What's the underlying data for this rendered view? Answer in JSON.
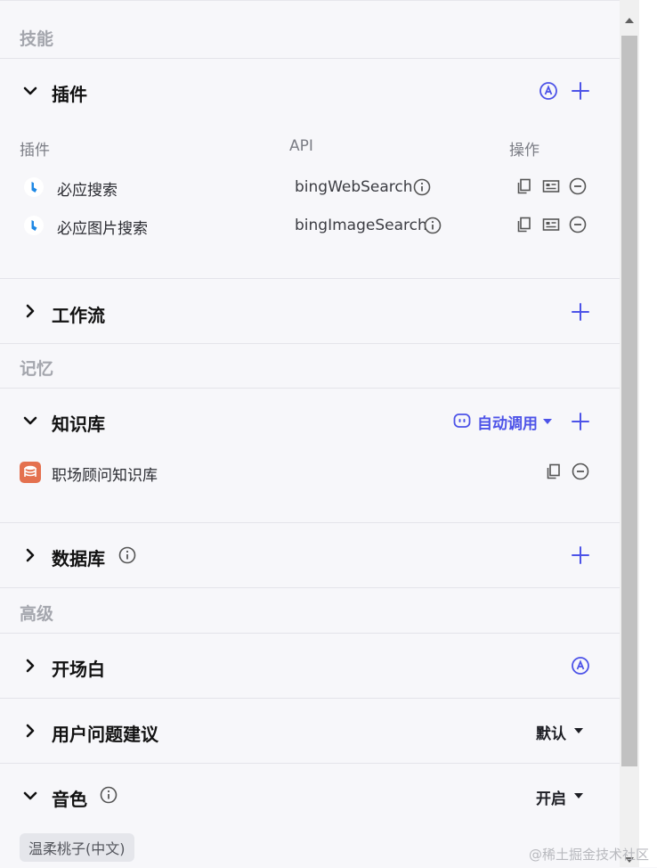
{
  "groups": {
    "skills": "技能",
    "memory": "记忆",
    "advanced": "高级"
  },
  "plugins": {
    "title": "插件",
    "columns": {
      "plugin": "插件",
      "api": "API",
      "actions": "操作"
    },
    "rows": [
      {
        "name": "必应搜索",
        "api": "bingWebSearch"
      },
      {
        "name": "必应图片搜索",
        "api": "bingImageSearch"
      }
    ]
  },
  "workflow": {
    "title": "工作流"
  },
  "knowledge": {
    "title": "知识库",
    "auto_call": "自动调用",
    "items": [
      {
        "name": "职场顾问知识库"
      }
    ]
  },
  "database": {
    "title": "数据库"
  },
  "opening": {
    "title": "开场白"
  },
  "suggestions": {
    "title": "用户问题建议",
    "value": "默认"
  },
  "voice": {
    "title": "音色",
    "value": "开启",
    "chip": "温柔桃子(中文)"
  },
  "watermark": "@稀土掘金技术社区",
  "colors": {
    "accent": "#4d53e8",
    "bing": "#1e88e5",
    "kb_icon": "#e4714f"
  }
}
